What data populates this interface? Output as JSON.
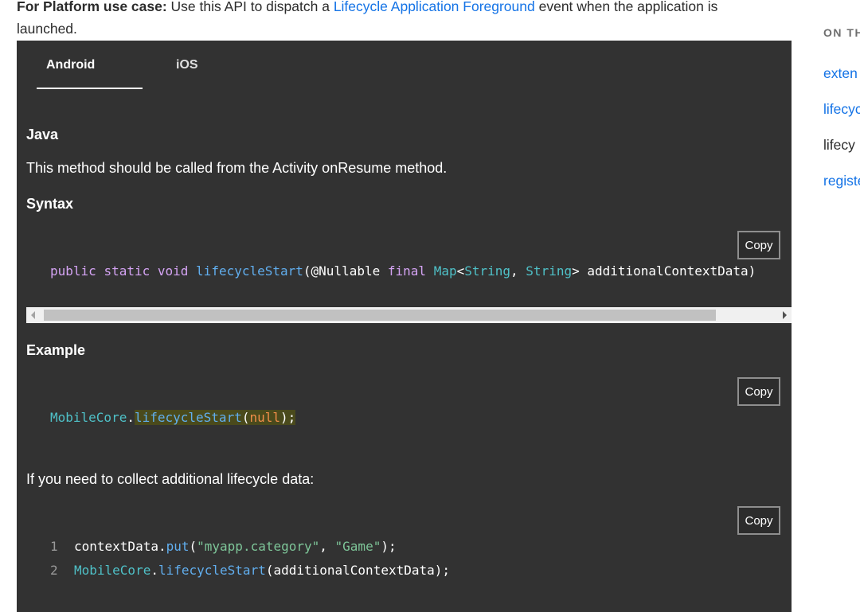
{
  "intro": {
    "bold": "For Platform use case:",
    "text1": " Use this API to dispatch a ",
    "link": "Lifecycle Application Foreground",
    "text2": " event when the application is launched."
  },
  "toc": {
    "heading": "ON TH",
    "items": [
      "exten",
      "lifecyc",
      "lifecy",
      "registe"
    ]
  },
  "tabs": [
    "Android",
    "iOS"
  ],
  "content": {
    "java_heading": "Java",
    "description": "This method should be called from the Activity onResume method.",
    "syntax_heading": "Syntax",
    "example_heading": "Example",
    "additional_text": "If you need to collect additional lifecycle data:"
  },
  "copy_label": "Copy",
  "code": {
    "syntax": {
      "kw1": "public",
      "kw2": "static",
      "kw3": "void",
      "fn": "lifecycleStart",
      "p1": "(@Nullable ",
      "kw4": "final",
      "ty1": "Map",
      "lt": "<",
      "ty2": "String",
      "comma": ", ",
      "ty3": "String",
      "gt": "> additionalContextData)"
    },
    "example": {
      "cls": "MobileCore",
      "dot": ".",
      "fn": "lifecycleStart",
      "open": "(",
      "arg": "null",
      "close": ");"
    },
    "additional": {
      "line1_num": "1",
      "line1_a": "contextData.",
      "line1_fn": "put",
      "line1_open": "(",
      "line1_s1": "\"myapp.category\"",
      "line1_comma": ", ",
      "line1_s2": "\"Game\"",
      "line1_close": ");",
      "line2_num": "2",
      "line2_cls": "MobileCore",
      "line2_dot": ".",
      "line2_fn": "lifecycleStart",
      "line2_rest": "(additionalContextData);"
    }
  }
}
